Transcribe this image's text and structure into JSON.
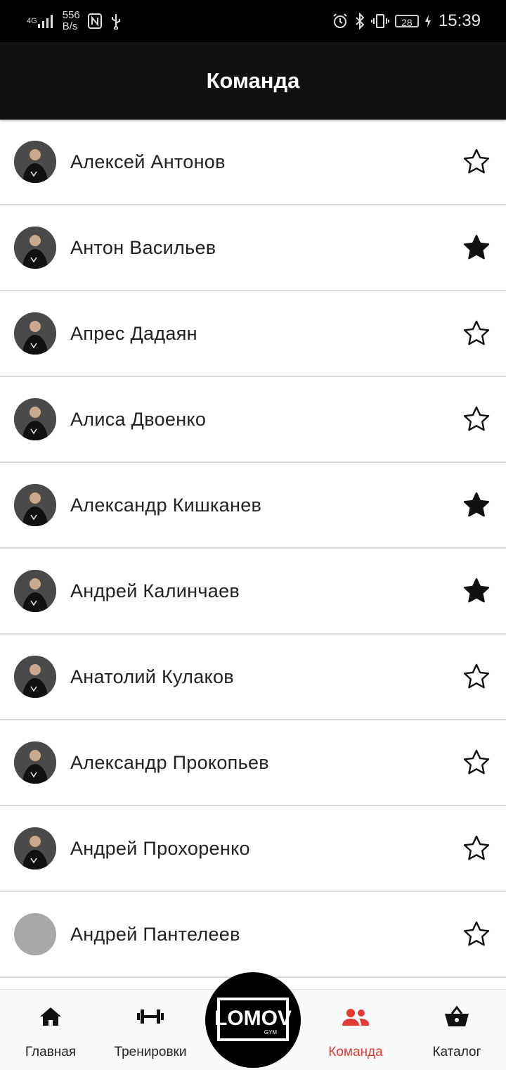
{
  "status_bar": {
    "network": "4G",
    "net_speed_value": "556",
    "net_speed_unit": "B/s",
    "battery": "28",
    "time": "15:39"
  },
  "header": {
    "title": "Команда"
  },
  "team": [
    {
      "name": "Алексей Антонов",
      "favorite": false,
      "has_photo": true
    },
    {
      "name": "Антон Васильев",
      "favorite": true,
      "has_photo": true
    },
    {
      "name": "Апрес Дадаян",
      "favorite": false,
      "has_photo": true
    },
    {
      "name": "Алиса Двоенко",
      "favorite": false,
      "has_photo": true
    },
    {
      "name": "Александр Кишканев",
      "favorite": true,
      "has_photo": true
    },
    {
      "name": "Андрей Калинчаев",
      "favorite": true,
      "has_photo": true
    },
    {
      "name": "Анатолий Кулаков",
      "favorite": false,
      "has_photo": true
    },
    {
      "name": "Александр Прокопьев",
      "favorite": false,
      "has_photo": true
    },
    {
      "name": "Андрей Прохоренко",
      "favorite": false,
      "has_photo": true
    },
    {
      "name": "Андрей Пантелеев",
      "favorite": false,
      "has_photo": false
    }
  ],
  "bottom_nav": {
    "home": "Главная",
    "workouts": "Тренировки",
    "logo": "LOMOV GYM",
    "team": "Команда",
    "catalog": "Каталог",
    "active": "team",
    "active_color": "#e53935"
  }
}
